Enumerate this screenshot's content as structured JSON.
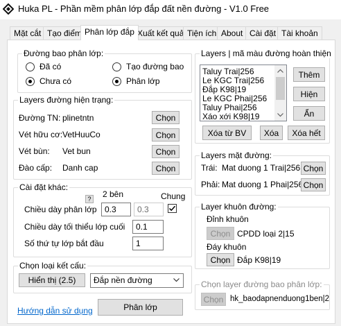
{
  "window": {
    "title": "Huka PL - Phần mềm phân lớp đắp đất nền đường - V1.0 Free"
  },
  "tabs": [
    {
      "label": "Mặt cắt"
    },
    {
      "label": "Tạo điểm"
    },
    {
      "label": "Phân lớp đắp"
    },
    {
      "label": "Xuất kết quả"
    },
    {
      "label": "Tiện ích"
    },
    {
      "label": "About"
    },
    {
      "label": "Cài đặt"
    },
    {
      "label": "Tài khoản"
    }
  ],
  "duong_bao": {
    "title": "Đường bao phân lớp:",
    "opt_da_co": "Đã có",
    "opt_chua_co": "Chưa có",
    "opt_tao_duong_bao": "Tạo đường bao",
    "opt_phan_lop": "Phân lớp"
  },
  "layers_hien_trang": {
    "title": "Layers đường hiện trạng:",
    "rows": [
      {
        "label": "Đường TN:",
        "value": "plinetntn",
        "button": "Chọn"
      },
      {
        "label": "Vét hữu cơ:",
        "value": "VetHuuCo",
        "button": "Chọn"
      },
      {
        "label": "Vét bùn:",
        "value": "Vet bun",
        "button": "Chọn"
      },
      {
        "label": "Đào cấp:",
        "value": "Danh cap",
        "button": "Chọn"
      }
    ]
  },
  "cai_dat_khac": {
    "title": "Cài đặt khác:",
    "help": "?",
    "col_2ben": "2 bên",
    "col_chung": "Chung",
    "chieu_day_label": "Chiều dày phân lớp",
    "chieu_day_value": "0.3",
    "chieu_day_value2": "0.3",
    "toi_thieu_label": "Chiều dày tối thiểu lớp cuối",
    "toi_thieu_value": "0.1",
    "so_thu_tu_label": "Số thứ tự lớp bắt đầu",
    "so_thu_tu_value": "1"
  },
  "ket_cau": {
    "title": "Chọn loại kết cấu:",
    "button": "Hiển thị (2.5)",
    "select_value": "Đắp nền đường"
  },
  "footer": {
    "guide_link": "Hướng dẫn sử dụng",
    "run_button": "Phân lớp"
  },
  "layers_hoan_thien": {
    "title": "Layers | mã màu đường hoàn thiện",
    "items": [
      "Taluy Trai|256",
      "Le KGC Trai|256",
      "Đắp  K98|19",
      "Le KGC Phai|256",
      "Taluy Phai|256",
      "Xáo xới K98|19"
    ],
    "btn_them": "Thêm",
    "btn_hien": "Hiện",
    "btn_an": "Ẩn",
    "btn_xoa_tu_bv": "Xóa từ BV",
    "btn_xoa": "Xóa",
    "btn_xoa_het": "Xóa hết"
  },
  "layers_mat_duong": {
    "title": "Layers mặt đường:",
    "trai_label": "Trái:",
    "trai_value": "Mat duong 1 Trai|256",
    "phai_label": "Phải:",
    "phai_value": "Mat duong 1 Phai|256",
    "button": "Chọn"
  },
  "khuon_duong": {
    "title": "Layer khuôn đường:",
    "dinh_label": "Đỉnh khuôn",
    "dinh_value": "CPDD loại 2|15",
    "day_label": "Đáy khuôn",
    "day_value": "Đắp  K98|19",
    "button": "Chọn"
  },
  "bao_phan_lop": {
    "title": "Chọn layer đường bao phân lớp:",
    "button": "Chọn",
    "value": "hk_baodapnenduong1ben|2"
  },
  "colors": {
    "accent": "#0066cc",
    "border": "#adadad",
    "window_bg": "#f0f0f0"
  }
}
